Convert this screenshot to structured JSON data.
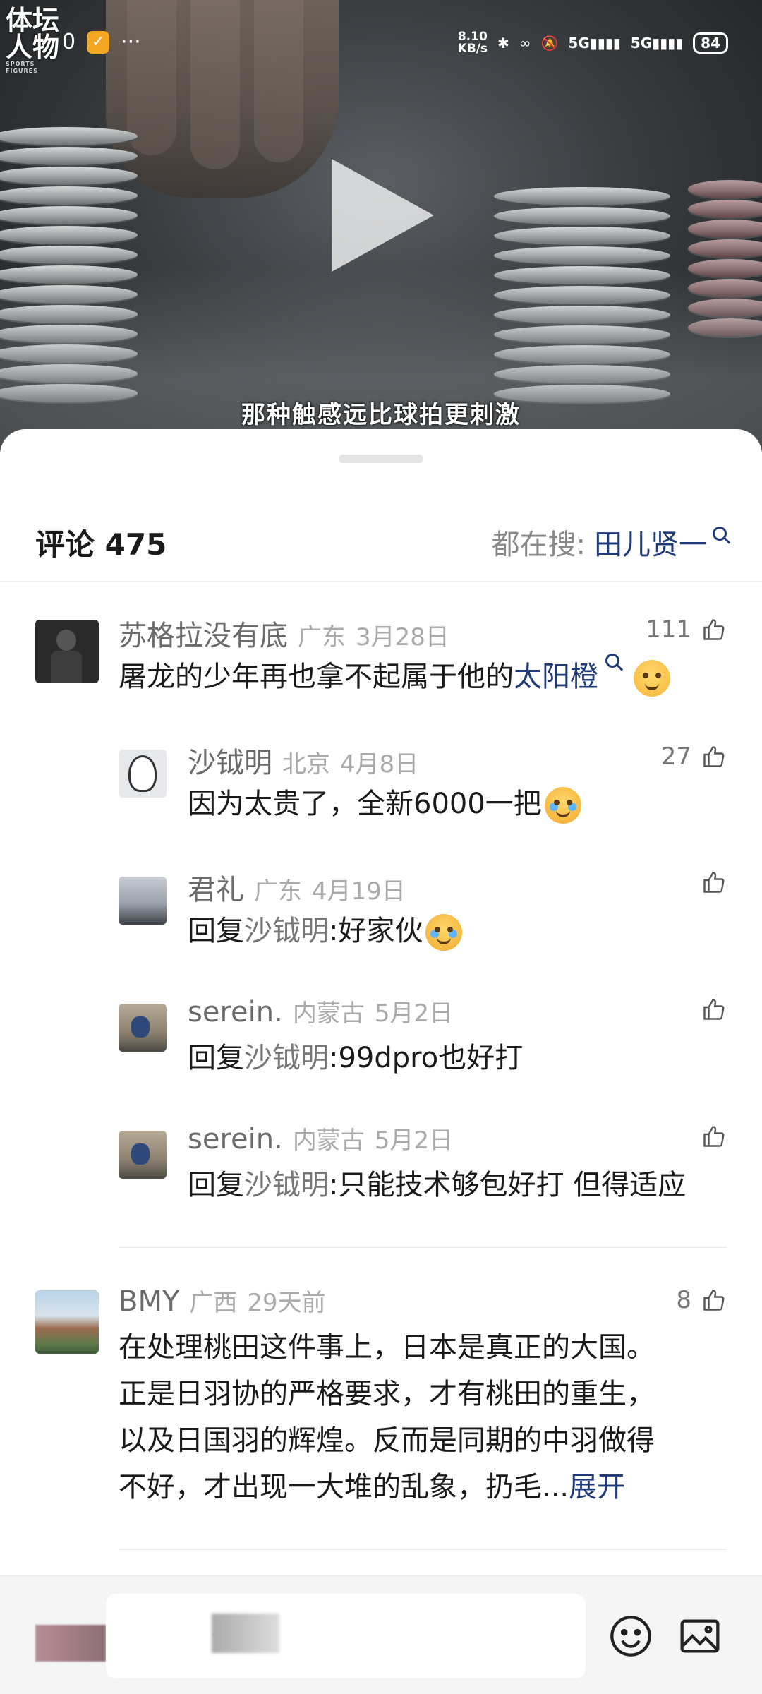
{
  "video": {
    "logo_line1": "体坛",
    "logo_line2": "人物",
    "logo_sub": "SPORTS FIGURES",
    "subtitle": "那种触感远比球拍更刺激"
  },
  "status_bar": {
    "left_digit": "0",
    "more": "···",
    "net_speed_value": "8.10",
    "net_speed_unit": "KB/s",
    "sim1": "5G",
    "sim2": "5G",
    "battery": "84"
  },
  "comments_header": {
    "title": "评论 475",
    "search_prefix": "都在搜:",
    "search_term": "田儿贤一"
  },
  "comments": [
    {
      "user": "苏格拉没有底",
      "location": "广东",
      "date": "3月28日",
      "likes": "111",
      "text_before": "屠龙的少年再也拿不起属于他的",
      "keyword": "太阳橙",
      "avatar_color": "#2a2a2a"
    },
    {
      "user": "沙钺明",
      "location": "北京",
      "date": "4月8日",
      "likes": "27",
      "text": "因为太贵了，全新6000一把",
      "avatar_color": "#d9dde3"
    },
    {
      "user": "君礼",
      "location": "广东",
      "date": "4月19日",
      "likes": "",
      "reply_prefix": "回复",
      "reply_to": "沙钺明",
      "text": ":好家伙",
      "avatar_color": "#7a8390"
    },
    {
      "user": "serein.",
      "location": "内蒙古",
      "date": "5月2日",
      "likes": "",
      "reply_prefix": "回复",
      "reply_to": "沙钺明",
      "text": ":99dpro也好打",
      "avatar_color": "#8d8270"
    },
    {
      "user": "serein.",
      "location": "内蒙古",
      "date": "5月2日",
      "likes": "",
      "reply_prefix": "回复",
      "reply_to": "沙钺明",
      "text": ":只能技术够包好打 但得适应",
      "avatar_color": "#8d8270"
    },
    {
      "user": "BMY",
      "location": "广西",
      "date": "29天前",
      "likes": "8",
      "line1": "在处理桃田这件事上，日本是真正的大国。",
      "line2": "正是日羽协的严格要求，才有桃田的重生，",
      "line3": "以及日国羽的辉煌。反而是同期的中羽做得",
      "line4": "不好，才出现一大堆的乱象，扔毛...",
      "expand": "展开",
      "avatar_color": "#6a8a5a"
    }
  ],
  "bottom_bar": {
    "input_placeholder": "论:"
  },
  "icons": {
    "emoji_button": "emoji-icon",
    "image_button": "image-icon",
    "like": "thumb-up-icon",
    "play": "play-icon"
  }
}
